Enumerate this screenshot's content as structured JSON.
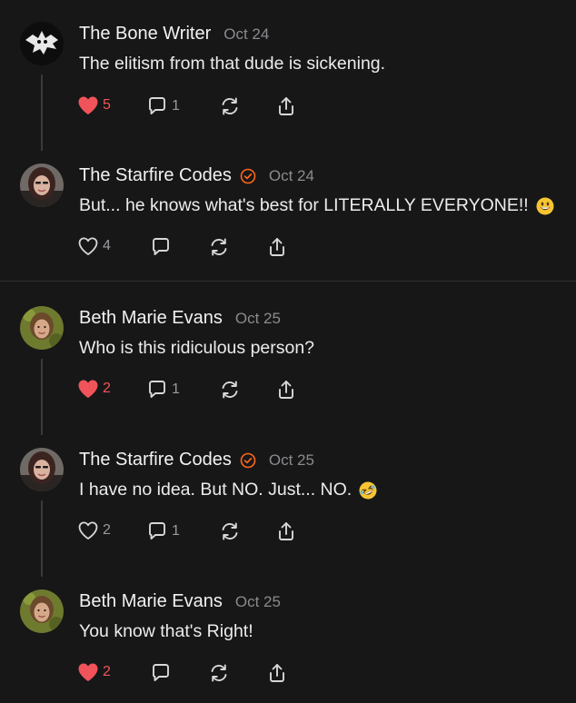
{
  "colors": {
    "background": "#171718",
    "like_active": "#f0545a",
    "accent_badge": "#ff6719",
    "muted_text": "#8b8b8f"
  },
  "comments": [
    {
      "author": "The Bone Writer",
      "date": "Oct 24",
      "text": "The elitism from that dude is sickening.",
      "likes": "5",
      "liked": true,
      "replies": "1",
      "verified": false,
      "avatar_icon": "bone-writer-avatar",
      "emoji": ""
    },
    {
      "author": "The Starfire Codes",
      "date": "Oct 24",
      "text": "But... he knows what's best for LITERALLY EVERYONE!!",
      "likes": "4",
      "liked": false,
      "replies": "",
      "verified": true,
      "avatar_icon": "starfire-avatar",
      "emoji": "grinning-face-emoji"
    },
    {
      "author": "Beth Marie Evans",
      "date": "Oct 25",
      "text": "Who is this ridiculous person?",
      "likes": "2",
      "liked": true,
      "replies": "1",
      "verified": false,
      "avatar_icon": "beth-avatar",
      "emoji": ""
    },
    {
      "author": "The Starfire Codes",
      "date": "Oct 25",
      "text": "I have no idea. But NO. Just... NO.",
      "likes": "2",
      "liked": false,
      "replies": "1",
      "verified": true,
      "avatar_icon": "starfire-avatar",
      "emoji": "rofl-emoji"
    },
    {
      "author": "Beth Marie Evans",
      "date": "Oct 25",
      "text": "You know that's Right!",
      "likes": "2",
      "liked": true,
      "replies": "",
      "verified": false,
      "avatar_icon": "beth-avatar",
      "emoji": ""
    }
  ]
}
